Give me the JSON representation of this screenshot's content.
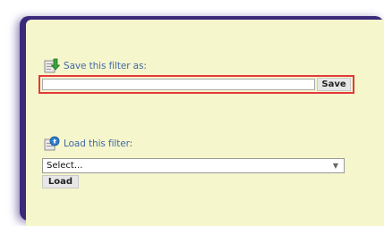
{
  "save_section": {
    "label": "Save this filter as:",
    "input_value": "",
    "button_label": "Save",
    "icon": "save-filter-icon"
  },
  "load_section": {
    "label": "Load this filter:",
    "selected": "Select...",
    "button_label": "Load",
    "icon": "load-filter-icon"
  },
  "colors": {
    "panel_bg": "#f6f6cc",
    "frame": "#3a2a7a",
    "label": "#3f69a6",
    "highlight_border": "#e23a3a"
  }
}
